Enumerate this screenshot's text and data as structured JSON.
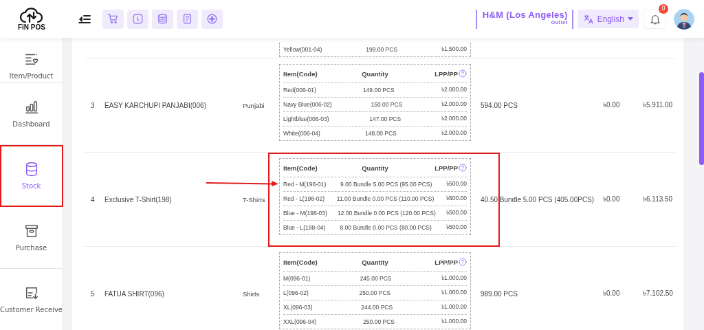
{
  "header": {
    "logo_text": "FiN POS",
    "store": {
      "name": "H&M (Los Angeles)",
      "type": "Outlet"
    },
    "language": "English",
    "notifications": "0"
  },
  "sidebar": {
    "items": [
      {
        "label": "Item/Product",
        "selected": false,
        "highlighted": false
      },
      {
        "label": "Dashboard",
        "selected": false,
        "highlighted": false
      },
      {
        "label": "Stock",
        "selected": true,
        "highlighted": true
      },
      {
        "label": "Purchase",
        "selected": false,
        "highlighted": false
      },
      {
        "label": "Customer Receive",
        "selected": false,
        "highlighted": false
      }
    ]
  },
  "table": {
    "rows": [
      {
        "variants": {
          "lines": [
            {
              "item": "Yellow(001-04)",
              "quantity": "199.00 PCS",
              "price": "৳1.500.00"
            }
          ]
        }
      },
      {
        "sl": "3",
        "name": "EASY KARCHUPI PANJABI(006)",
        "category": "Punjabi",
        "variants": {
          "columns": [
            "Item(Code)",
            "Quantity",
            "LPP/PP"
          ],
          "lines": [
            {
              "item": "Red(006-01)",
              "quantity": "149.00 PCS",
              "price": "৳2.000.00"
            },
            {
              "item": "Navy Blue(006-02)",
              "quantity": "150.00 PCS",
              "price": "৳2.000.00"
            },
            {
              "item": "Lightblue(006-03)",
              "quantity": "147.00 PCS",
              "price": "৳2.000.00"
            },
            {
              "item": "White(006-04)",
              "quantity": "148.00 PCS",
              "price": "৳2.000.00"
            }
          ]
        },
        "total_quantity": "594.00 PCS",
        "discount": "৳0.00",
        "value": "৳5.911.00",
        "highlighted": false
      },
      {
        "sl": "4",
        "name": "Exclusive T-Shirt(198)",
        "category": "T-Shirts",
        "variants": {
          "columns": [
            "Item(Code)",
            "Quantity",
            "LPP/PP"
          ],
          "lines": [
            {
              "item": "Red - M(198-01)",
              "quantity": "9.00 Bundle 5.00 PCS (95.00 PCS)",
              "price": "৳500.00"
            },
            {
              "item": "Red - L(198-02)",
              "quantity": "11.00 Bundle 0.00 PCS (110.00 PCS)",
              "price": "৳500.00"
            },
            {
              "item": "Blue - M(198-03)",
              "quantity": "12.00 Bundle 0.00 PCS (120.00 PCS)",
              "price": "৳500.00"
            },
            {
              "item": "Blue - L(198-04)",
              "quantity": "8.00 Bundle 0.00 PCS (80.00 PCS)",
              "price": "৳500.00"
            }
          ]
        },
        "total_quantity": "40.50 Bundle 5.00 PCS (405.00PCS)",
        "discount": "৳0.00",
        "value": "৳6.113.50",
        "highlighted": true
      },
      {
        "sl": "5",
        "name": "FATUA SHIRT(096)",
        "category": "Shirts",
        "variants": {
          "columns": [
            "Item(Code)",
            "Quantity",
            "LPP/PP"
          ],
          "lines": [
            {
              "item": "M(096-01)",
              "quantity": "245.00 PCS",
              "price": "৳1.000.00"
            },
            {
              "item": "L(096-02)",
              "quantity": "250.00 PCS",
              "price": "৳1.000.00"
            },
            {
              "item": "XL(096-03)",
              "quantity": "244.00 PCS",
              "price": "৳1.000.00"
            },
            {
              "item": "XXL(096-04)",
              "quantity": "250.00 PCS",
              "price": "৳1.000.00"
            }
          ]
        },
        "total_quantity": "989.00 PCS",
        "discount": "৳0.00",
        "value": "৳7.102.50",
        "highlighted": false
      }
    ]
  }
}
